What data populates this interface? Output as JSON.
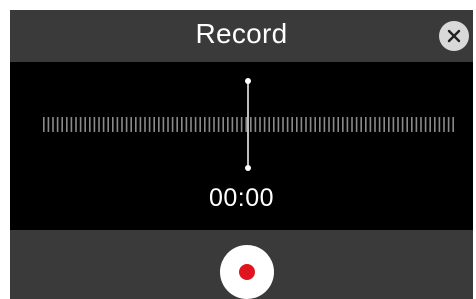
{
  "header": {
    "title": "Record"
  },
  "close_icon": "close-icon",
  "timer": {
    "elapsed": "00:00"
  },
  "record_icon": "record-dot-icon",
  "colors": {
    "panel_bg": "#3a3a3a",
    "wave_bg": "#000000",
    "close_button": "#d9d9d9",
    "record_dot": "#e0141e",
    "text": "#ffffff"
  }
}
